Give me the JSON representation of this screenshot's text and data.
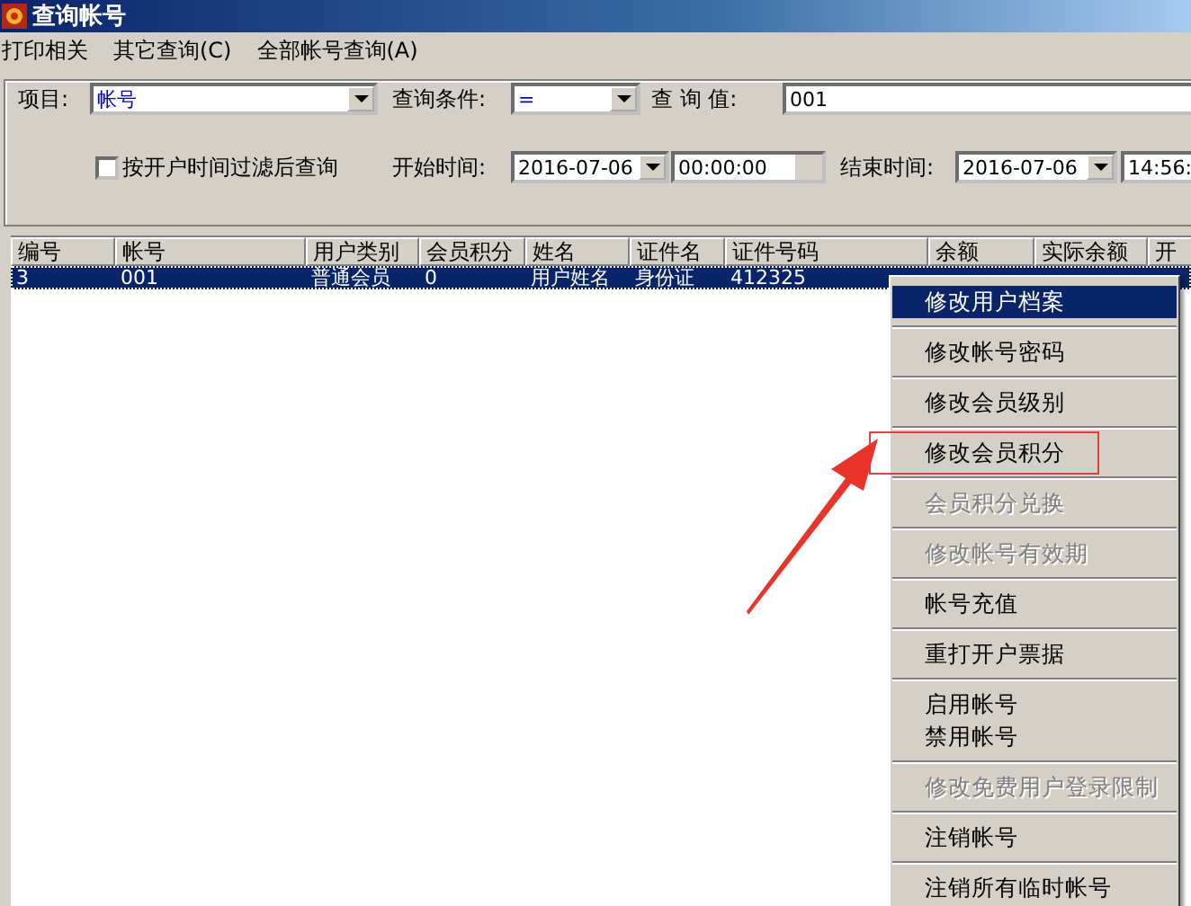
{
  "window": {
    "title": "查询帐号"
  },
  "menubar": [
    "打印相关",
    "其它查询(C)",
    "全部帐号查询(A)"
  ],
  "query": {
    "item_label": "项目:",
    "item_value": "帐号",
    "condition_label": "查询条件:",
    "condition_value": "=",
    "value_label": "查 询 值:",
    "value": "001",
    "filter": {
      "label": "按开户时间过滤后查询",
      "checked": false
    },
    "start_label": "开始时间:",
    "start_date": "2016-07-06",
    "start_time": "00:00:00",
    "end_label": "结束时间:",
    "end_date": "2016-07-06",
    "end_time": "14:56:"
  },
  "table": {
    "columns": [
      "编号",
      "帐号",
      "用户类别",
      "会员积分",
      "姓名",
      "证件名",
      "证件号码",
      "余额",
      "实际余额",
      "开"
    ],
    "rows": [
      {
        "cells": [
          "3",
          "001",
          "普通会员",
          "0",
          "用户姓名",
          "身份证",
          "412325"
        ],
        "selected": true
      }
    ]
  },
  "context_menu": {
    "groups": [
      [
        {
          "label": "修改用户档案",
          "selected": true,
          "disabled": false,
          "highlighted": false
        }
      ],
      [
        {
          "label": "修改帐号密码",
          "selected": false,
          "disabled": false,
          "highlighted": false
        }
      ],
      [
        {
          "label": "修改会员级别",
          "selected": false,
          "disabled": false,
          "highlighted": false
        }
      ],
      [
        {
          "label": "修改会员积分",
          "selected": false,
          "disabled": false,
          "highlighted": true
        }
      ],
      [
        {
          "label": "会员积分兑换",
          "selected": false,
          "disabled": true,
          "highlighted": false
        }
      ],
      [
        {
          "label": "修改帐号有效期",
          "selected": false,
          "disabled": true,
          "highlighted": false
        }
      ],
      [
        {
          "label": "帐号充值",
          "selected": false,
          "disabled": false,
          "highlighted": false
        }
      ],
      [
        {
          "label": "重打开户票据",
          "selected": false,
          "disabled": false,
          "highlighted": false
        }
      ],
      [
        {
          "label": "启用帐号",
          "selected": false,
          "disabled": false,
          "highlighted": false
        },
        {
          "label": "禁用帐号",
          "selected": false,
          "disabled": false,
          "highlighted": false
        }
      ],
      [
        {
          "label": "修改免费用户登录限制",
          "selected": false,
          "disabled": true,
          "highlighted": false
        }
      ],
      [
        {
          "label": "注销帐号",
          "selected": false,
          "disabled": false,
          "highlighted": false
        }
      ],
      [
        {
          "label": "注销所有临时帐号",
          "selected": false,
          "disabled": false,
          "highlighted": false
        }
      ]
    ]
  }
}
